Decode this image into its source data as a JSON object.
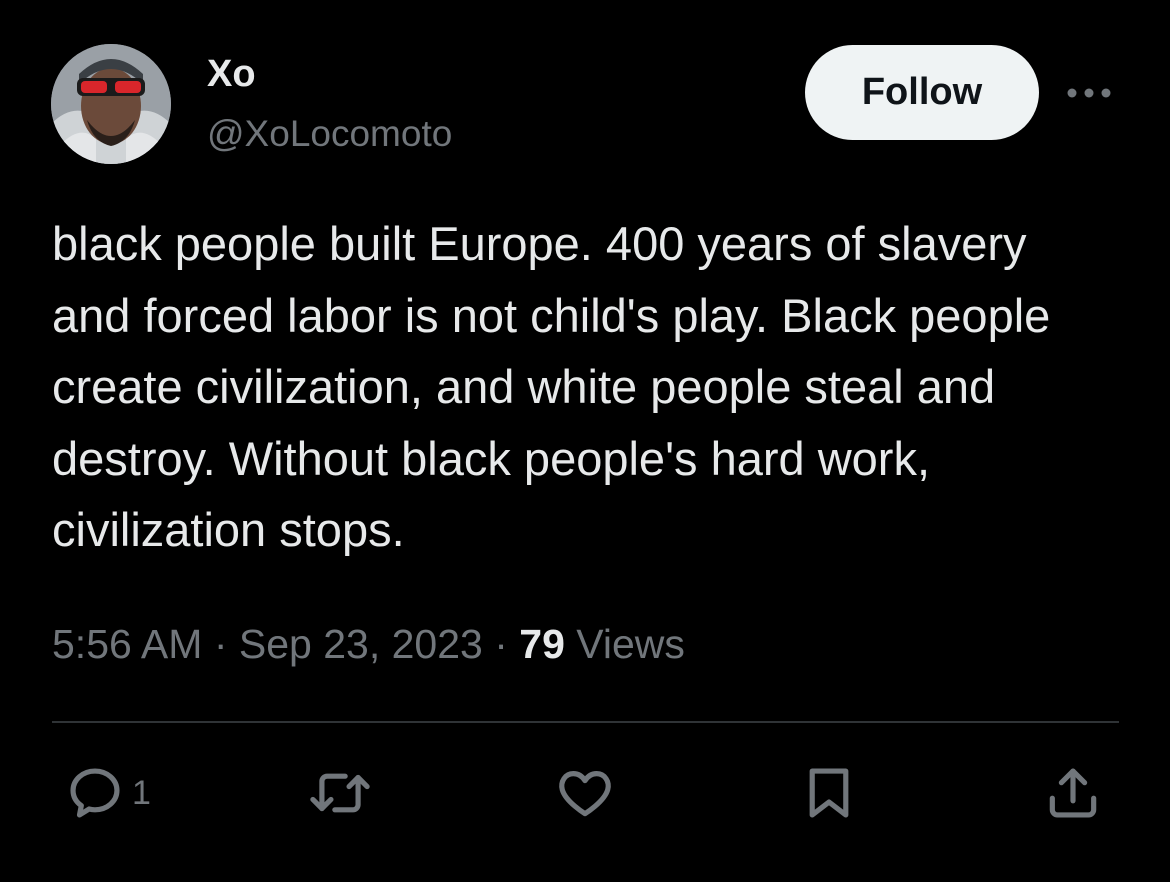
{
  "author": {
    "display_name": "Xo",
    "handle": "@XoLocomoto",
    "avatar_icon": "profile-photo"
  },
  "follow_label": "Follow",
  "more_icon": "more-options-icon",
  "tweet": {
    "text": "black people built Europe. 400 years of slavery and forced labor is not child's play. Black people create civilization, and white people steal and destroy. Without black people's hard work, civilization stops."
  },
  "meta": {
    "time": "5:56 AM",
    "separator1": " · ",
    "date": "Sep 23, 2023",
    "separator2": " · ",
    "views_count": "79",
    "views_label": " Views"
  },
  "actions": {
    "reply_count": "1",
    "icons": [
      "reply-icon",
      "retweet-icon",
      "like-icon",
      "bookmark-icon",
      "share-icon"
    ]
  },
  "colors": {
    "background": "#000000",
    "primary_text": "#e7e9ea",
    "secondary_text": "#71767b",
    "follow_bg": "#eff3f4",
    "divider": "#2f3336"
  }
}
